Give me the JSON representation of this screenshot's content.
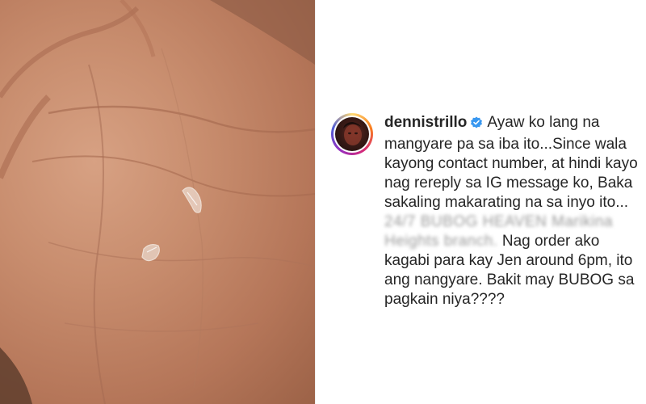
{
  "post": {
    "username": "dennistrillo",
    "verified_icon": "verified-badge-icon",
    "caption_part1": "Ayaw ko lang na mangyare pa sa iba ito...Since wala kayong contact number, at hindi kayo nag rereply sa IG message ko, Baka sakaling makarating na sa inyo ito...",
    "caption_blurred": "24/7 BUBOG HEAVEN Marikina Heights branch.",
    "caption_part2": "Nag order ako kagabi para kay Jen around 6pm, ito ang nangyare. Bakit may BUBOG sa pagkain niya????"
  },
  "colors": {
    "verified_blue": "#3897f0",
    "text": "#262626"
  }
}
